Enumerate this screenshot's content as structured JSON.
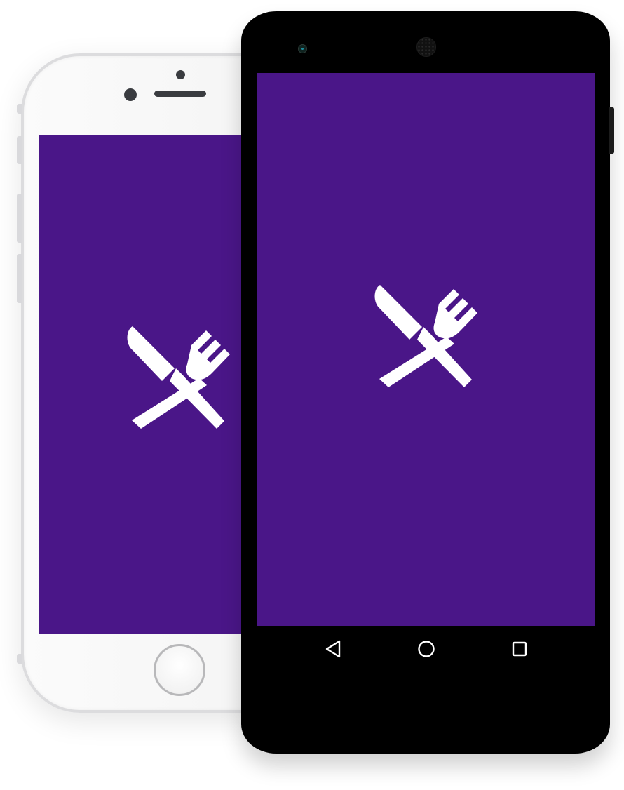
{
  "colors": {
    "splash_background": "#4a1688",
    "logo": "#ffffff",
    "android_body": "#000000",
    "iphone_body": "#f5f5f5"
  },
  "iphone": {
    "screen": {
      "logo_icon": "fork-knife-icon"
    },
    "home_button_icon": "home-button-icon"
  },
  "android": {
    "screen": {
      "logo_icon": "fork-knife-icon"
    },
    "nav_bar": {
      "back_icon": "back-triangle-icon",
      "home_icon": "home-circle-icon",
      "recents_icon": "recents-square-icon"
    }
  }
}
